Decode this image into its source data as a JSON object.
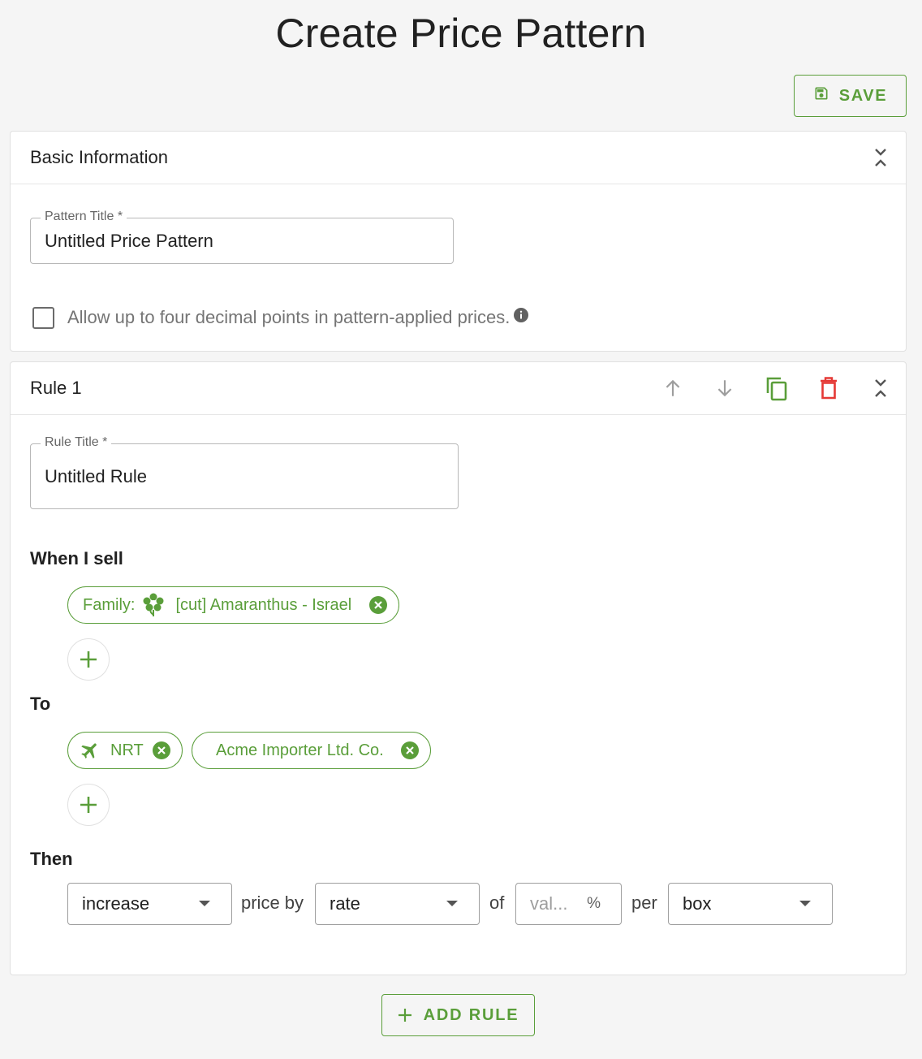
{
  "page": {
    "title": "Create Price Pattern"
  },
  "toolbar": {
    "save_label": "SAVE"
  },
  "colors": {
    "accent": "#5a9e3a",
    "danger": "#e53935",
    "muted": "#9e9e9e"
  },
  "basic_info": {
    "header": "Basic Information",
    "pattern_title_label": "Pattern Title *",
    "pattern_title_value": "Untitled Price Pattern",
    "decimal_checkbox_label": "Allow up to four decimal points in pattern-applied prices.",
    "decimal_checkbox_checked": false
  },
  "rule": {
    "header": "Rule 1",
    "rule_title_label": "Rule Title *",
    "rule_title_value": "Untitled Rule",
    "when_label": "When I sell",
    "when_chips": [
      {
        "prefix": "Family:",
        "icon": "flower-icon",
        "label": "[cut] Amaranthus - Israel"
      }
    ],
    "to_label": "To",
    "to_chips": [
      {
        "icon": "airplane-icon",
        "label": "NRT"
      },
      {
        "label": "Acme Importer Ltd. Co."
      }
    ],
    "then_label": "Then",
    "action_select": "increase",
    "price_by_text": "price by",
    "method_select": "rate",
    "of_text": "of",
    "value_placeholder": "val...",
    "value_unit": "%",
    "per_text": "per",
    "unit_select": "box"
  },
  "footer": {
    "add_rule_label": "ADD RULE"
  }
}
